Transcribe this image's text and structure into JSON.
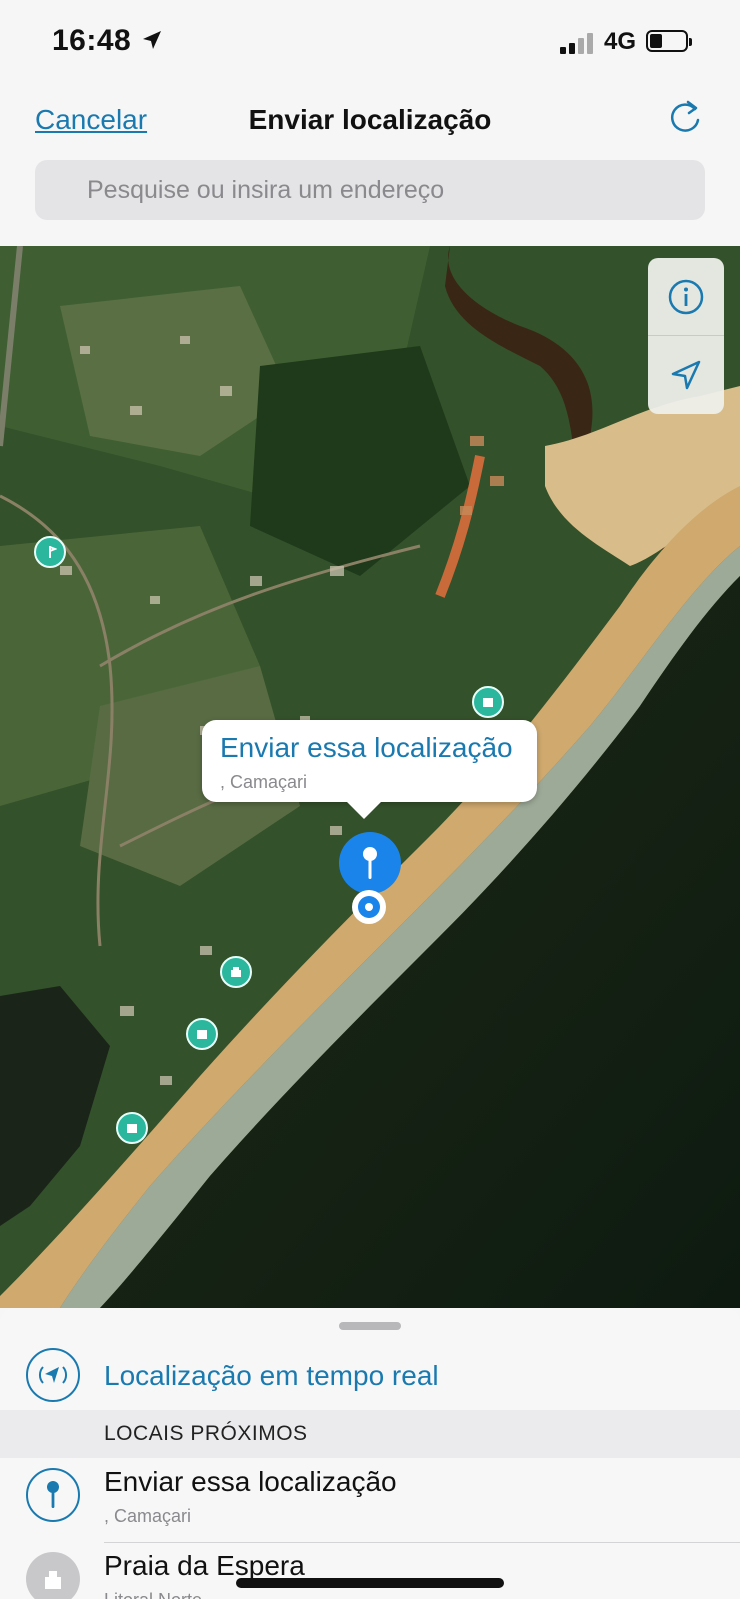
{
  "status_bar": {
    "time": "16:48",
    "network": "4G",
    "icons": [
      "location-arrow-icon",
      "signal-icon",
      "battery-icon"
    ]
  },
  "header": {
    "cancel_label": "Cancelar",
    "title": "Enviar localização",
    "refresh_icon": "refresh-icon"
  },
  "search": {
    "placeholder": "Pesquise ou insira um endereço"
  },
  "map": {
    "controls": [
      "info-icon",
      "navigation-arrow-icon"
    ],
    "callout": {
      "title": "Enviar essa localização",
      "subtitle": ", Camaçari"
    }
  },
  "sheet": {
    "live_location_label": "Localização em tempo real",
    "section_header": "LOCAIS PRÓXIMOS",
    "items": [
      {
        "title": "Enviar essa localização",
        "subtitle": ", Camaçari",
        "icon": "pin-icon"
      },
      {
        "title": "Praia da Espera",
        "subtitle": "Litoral Norte",
        "icon": "place-icon"
      }
    ]
  },
  "colors": {
    "accent": "#1a7ab0",
    "pin": "#1a84ea",
    "poi": "#2ab79e"
  }
}
